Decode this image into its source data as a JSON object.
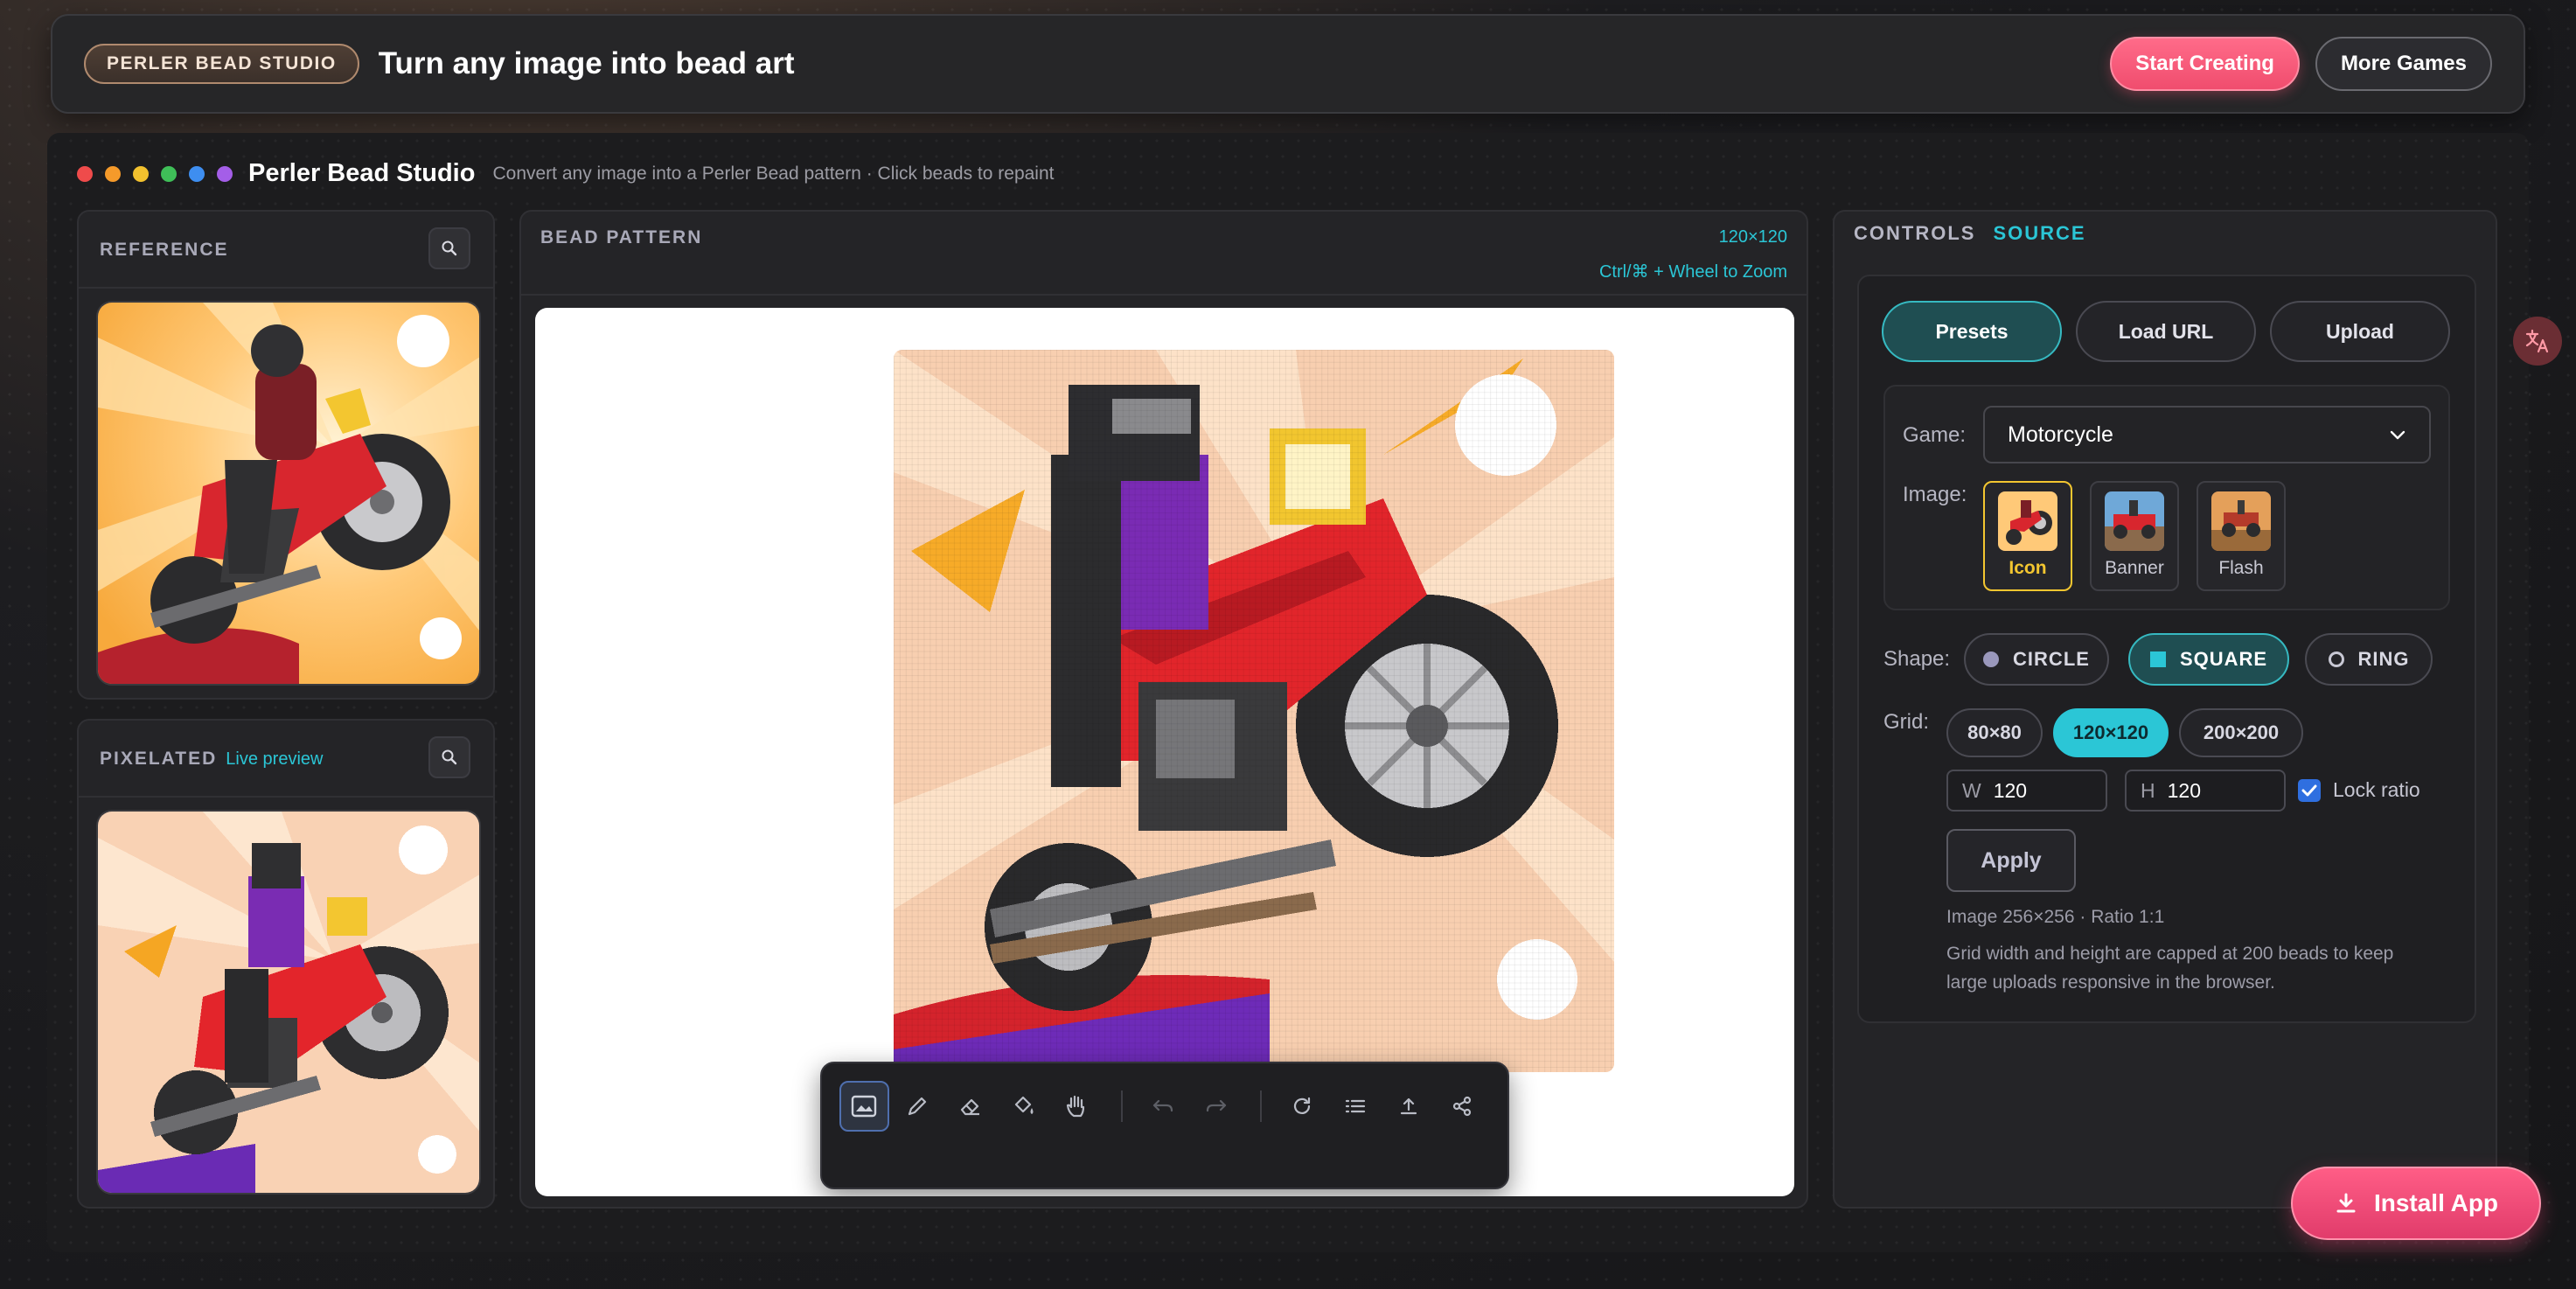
{
  "topbar": {
    "badge": "PERLER BEAD STUDIO",
    "title": "Turn any image into bead art",
    "start_button": "Start Creating",
    "more_button": "More Games"
  },
  "app": {
    "name": "Perler Bead Studio",
    "subtitle": "Convert any image into a Perler Bead pattern · Click beads to repaint",
    "dot_colors": [
      "#ef4b4b",
      "#f59a2a",
      "#f2c12e",
      "#3fbf58",
      "#3e8ef0",
      "#a45ee8"
    ]
  },
  "reference": {
    "label": "REFERENCE"
  },
  "pixelated": {
    "label": "PIXELATED",
    "badge": "Live preview"
  },
  "pattern": {
    "label": "BEAD PATTERN",
    "size": "120×120",
    "zoom_hint": "Ctrl/⌘ + Wheel to Zoom"
  },
  "toolbar": {
    "tools": [
      "image-icon",
      "pencil-icon",
      "eraser-icon",
      "fill-bucket-icon",
      "hand-icon",
      "undo-icon",
      "redo-icon",
      "refresh-icon",
      "list-icon",
      "export-icon",
      "share-icon"
    ],
    "active": "image-icon"
  },
  "controls": {
    "tab_controls": "CONTROLS",
    "tab_source": "SOURCE",
    "source_buttons": [
      "Presets",
      "Load URL",
      "Upload"
    ],
    "active_source": "Presets",
    "game_label": "Game:",
    "game_value": "Motorcycle",
    "image_label": "Image:",
    "images": [
      "Icon",
      "Banner",
      "Flash"
    ],
    "active_image": "Icon",
    "shape_label": "Shape:",
    "shapes": [
      "CIRCLE",
      "SQUARE",
      "RING"
    ],
    "active_shape": "SQUARE",
    "grid_label": "Grid:",
    "grids": [
      "80×80",
      "120×120",
      "200×200"
    ],
    "active_grid": "120×120",
    "w_label": "W",
    "w_value": "120",
    "h_label": "H",
    "h_value": "120",
    "lock_label": "Lock ratio",
    "lock_checked": true,
    "apply": "Apply",
    "image_info": "Image 256×256 · Ratio 1:1",
    "cap_note_1": "Grid width and height are capped at 200 beads to keep",
    "cap_note_2": "large uploads responsive in the browser."
  },
  "install": {
    "label": "Install App"
  },
  "accent": {
    "teal": "#2bc6d6",
    "pink": "#f04d6e",
    "gold": "#f3c630"
  }
}
